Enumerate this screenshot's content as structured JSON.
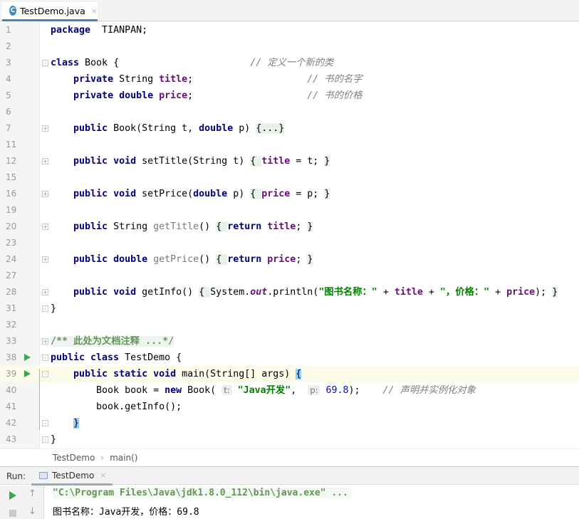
{
  "tab": {
    "title": "TestDemo.java",
    "icon": "java-class-icon",
    "close": "×"
  },
  "code": [
    {
      "n": "1",
      "t": [
        [
          "kw",
          "package"
        ],
        [
          "",
          "  TIANPAN;"
        ]
      ]
    },
    {
      "n": "2",
      "t": []
    },
    {
      "n": "3",
      "fold": "-",
      "t": [
        [
          "kw",
          "class"
        ],
        [
          "",
          " Book {                       "
        ],
        [
          "cm",
          "// 定义一个新的类"
        ]
      ]
    },
    {
      "n": "4",
      "t": [
        [
          "",
          "    "
        ],
        [
          "kw",
          "private"
        ],
        [
          "",
          " String "
        ],
        [
          "fld",
          "title"
        ],
        [
          "",
          ";                    "
        ],
        [
          "cm",
          "// 书的名字"
        ]
      ]
    },
    {
      "n": "5",
      "t": [
        [
          "",
          "    "
        ],
        [
          "kw",
          "private double"
        ],
        [
          "",
          " "
        ],
        [
          "fld",
          "price"
        ],
        [
          "",
          ";                    "
        ],
        [
          "cm",
          "// 书的价格"
        ]
      ]
    },
    {
      "n": "6",
      "t": []
    },
    {
      "n": "7",
      "fold": "+",
      "t": [
        [
          "",
          "    "
        ],
        [
          "kw",
          "public"
        ],
        [
          "",
          " Book(String t, "
        ],
        [
          "kw",
          "double"
        ],
        [
          "",
          " p) "
        ],
        [
          "fb",
          "{...}"
        ]
      ]
    },
    {
      "n": "11",
      "t": []
    },
    {
      "n": "12",
      "fold": "+",
      "t": [
        [
          "",
          "    "
        ],
        [
          "kw",
          "public void"
        ],
        [
          "",
          " setTitle(String t) "
        ],
        [
          "fb",
          "{ "
        ],
        [
          "fld",
          "title"
        ],
        [
          "",
          " = t; "
        ],
        [
          "fb",
          "}"
        ]
      ]
    },
    {
      "n": "15",
      "t": []
    },
    {
      "n": "16",
      "fold": "+",
      "t": [
        [
          "",
          "    "
        ],
        [
          "kw",
          "public void"
        ],
        [
          "",
          " setPrice("
        ],
        [
          "kw",
          "double"
        ],
        [
          "",
          " p) "
        ],
        [
          "fb",
          "{ "
        ],
        [
          "fld",
          "price"
        ],
        [
          "",
          " = p; "
        ],
        [
          "fb",
          "}"
        ]
      ]
    },
    {
      "n": "19",
      "t": []
    },
    {
      "n": "20",
      "fold": "+",
      "t": [
        [
          "",
          "    "
        ],
        [
          "kw",
          "public"
        ],
        [
          "",
          " String "
        ],
        [
          "gm",
          "getTitle"
        ],
        [
          "",
          "() "
        ],
        [
          "fb",
          "{ "
        ],
        [
          "kw",
          "return"
        ],
        [
          "",
          " "
        ],
        [
          "fld",
          "title"
        ],
        [
          "",
          "; "
        ],
        [
          "fb",
          "}"
        ]
      ]
    },
    {
      "n": "23",
      "t": []
    },
    {
      "n": "24",
      "fold": "+",
      "t": [
        [
          "",
          "    "
        ],
        [
          "kw",
          "public double"
        ],
        [
          "",
          " "
        ],
        [
          "gm",
          "getPrice"
        ],
        [
          "",
          "() "
        ],
        [
          "fb",
          "{ "
        ],
        [
          "kw",
          "return"
        ],
        [
          "",
          " "
        ],
        [
          "fld",
          "price"
        ],
        [
          "",
          "; "
        ],
        [
          "fb",
          "}"
        ]
      ]
    },
    {
      "n": "27",
      "t": []
    },
    {
      "n": "28",
      "fold": "+",
      "t": [
        [
          "",
          "    "
        ],
        [
          "kw",
          "public void"
        ],
        [
          "",
          " getInfo() "
        ],
        [
          "fb",
          "{ "
        ],
        [
          "",
          "System."
        ],
        [
          "it",
          "out"
        ],
        [
          "",
          ".println("
        ],
        [
          "str",
          "\"图书名称：\""
        ],
        [
          "",
          " + "
        ],
        [
          "fld",
          "title"
        ],
        [
          "",
          " + "
        ],
        [
          "str",
          "\"，价格：\""
        ],
        [
          "",
          " + "
        ],
        [
          "fld",
          "price"
        ],
        [
          "",
          "); "
        ],
        [
          "fb",
          "}"
        ]
      ]
    },
    {
      "n": "31",
      "fold": "-",
      "t": [
        [
          "",
          "}"
        ]
      ]
    },
    {
      "n": "32",
      "t": []
    },
    {
      "n": "33",
      "fold": "+",
      "t": [
        [
          "doc",
          "/** 此处为文档注释 ...*/"
        ]
      ]
    },
    {
      "n": "38",
      "run": true,
      "fold": "-",
      "t": [
        [
          "kw",
          "public class"
        ],
        [
          "",
          " TestDemo {"
        ]
      ]
    },
    {
      "n": "39",
      "run": true,
      "fold": "-",
      "cur": true,
      "t": [
        [
          "",
          "    "
        ],
        [
          "kw",
          "public static void"
        ],
        [
          "",
          " main(String[] args) "
        ],
        [
          "brm",
          "{"
        ]
      ]
    },
    {
      "n": "40",
      "t": [
        [
          "",
          "        Book book = "
        ],
        [
          "kw",
          "new"
        ],
        [
          "",
          " Book( "
        ],
        [
          "hint",
          "t:"
        ],
        [
          "",
          " "
        ],
        [
          "str",
          "\"Java开发\""
        ],
        [
          "",
          ",  "
        ],
        [
          "hint",
          "p:"
        ],
        [
          "",
          " "
        ],
        [
          "num",
          "69.8"
        ],
        [
          "",
          ");    "
        ],
        [
          "cm",
          "// 声明并实例化对象"
        ]
      ]
    },
    {
      "n": "41",
      "t": [
        [
          "",
          "        book.getInfo();"
        ]
      ]
    },
    {
      "n": "42",
      "fold": "-",
      "t": [
        [
          "",
          "    "
        ],
        [
          "brm",
          "}"
        ]
      ]
    },
    {
      "n": "43",
      "fold": "-",
      "t": [
        [
          "",
          "}"
        ]
      ]
    }
  ],
  "breadcrumb": {
    "class": "TestDemo",
    "sep": "›",
    "method": "main()"
  },
  "run": {
    "label": "Run:",
    "tab": "TestDemo",
    "close": "×"
  },
  "console": {
    "command": "\"C:\\Program Files\\Java\\jdk1.8.0_112\\bin\\java.exe\" ...",
    "output": "图书名称：Java开发，价格：69.8",
    "up": "↑",
    "down": "↓"
  }
}
